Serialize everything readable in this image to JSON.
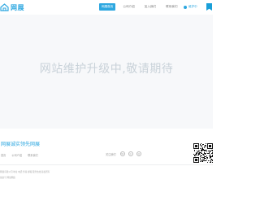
{
  "header": {
    "logo_text": "网展",
    "nav": [
      "网展首页",
      "公司介绍",
      "加入我们",
      "联系我们"
    ],
    "active_index": 0,
    "cta_label": "维护中"
  },
  "hero": {
    "message": "网站维护升级中,敬请期待"
  },
  "footer": {
    "brand": "网展诚实领先网展",
    "links": [
      "首页",
      "公司介绍",
      "联系我们"
    ],
    "follow_label": "关注我们",
    "social_icons": [
      "weibo-icon",
      "wechat-icon",
      "qq-icon"
    ],
    "line1": "网展有限公司 地址 电话 传真 邮箱 服务热线 版权所有",
    "line2": "备案号 网展网络"
  },
  "colors": {
    "accent": "#2da7e0",
    "hero_bg": "#f7f8fa",
    "hero_text": "#c9d2d9"
  }
}
